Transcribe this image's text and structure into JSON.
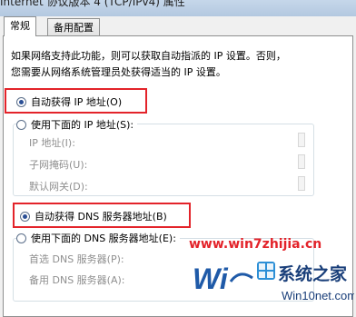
{
  "window": {
    "title": "Internet 协议版本 4 (TCP/IPv4) 属性"
  },
  "tabs": [
    {
      "label": "常规",
      "active": true
    },
    {
      "label": "备用配置",
      "active": false
    }
  ],
  "description": {
    "line1": "如果网络支持此功能，则可以获取自动指派的 IP 设置。否则，",
    "line2": "您需要从网络系统管理员处获得适当的 IP 设置。"
  },
  "ip": {
    "auto_label": "自动获得 IP 地址(O)",
    "auto_selected": true,
    "manual_label": "使用下面的 IP 地址(S):",
    "fields": [
      {
        "label": "IP 地址(I):"
      },
      {
        "label": "子网掩码(U):"
      },
      {
        "label": "默认网关(D):"
      }
    ]
  },
  "dns": {
    "auto_label": "自动获得 DNS 服务器地址(B)",
    "auto_selected": true,
    "manual_label": "使用下面的 DNS 服务器地址(E):",
    "fields": [
      {
        "label": "首选 DNS 服务器(P):"
      },
      {
        "label": "备用 DNS 服务器(A):"
      }
    ]
  },
  "watermark": {
    "url": "www.win7zhijia.cn",
    "brand_main": "系统之家",
    "brand_site": "Win10net.com"
  },
  "colors": {
    "highlight": "#e3232a",
    "accent": "#2a4f95"
  }
}
